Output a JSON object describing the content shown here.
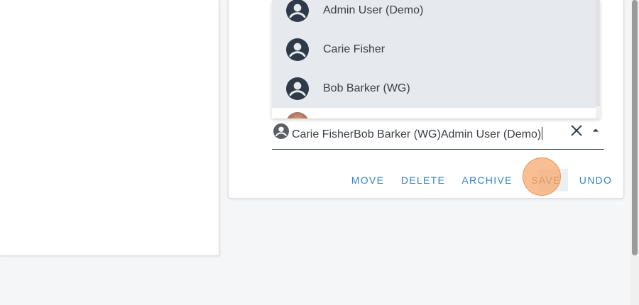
{
  "dropdown": {
    "options": [
      {
        "label": "Admin User (Demo)",
        "icon": "account-circle-icon"
      },
      {
        "label": "Carie Fisher",
        "icon": "account-circle-icon"
      },
      {
        "label": "Bob Barker (WG)",
        "icon": "account-circle-icon"
      }
    ]
  },
  "field": {
    "value": "Carie FisherBob Barker (WG)Admin User (Demo)",
    "icon": "account-circle-icon",
    "clear_icon": "close-icon",
    "toggle_icon": "arrow-up-icon"
  },
  "actions": {
    "move": "MOVE",
    "delete": "DELETE",
    "archive": "ARCHIVE",
    "save": "SAVE",
    "undo": "UNDO"
  },
  "colors": {
    "accent": "#2f86c8",
    "icon_dark": "#2e3a48",
    "option_bg": "#e6e9ee",
    "click_highlight": "#f7aa6e"
  }
}
